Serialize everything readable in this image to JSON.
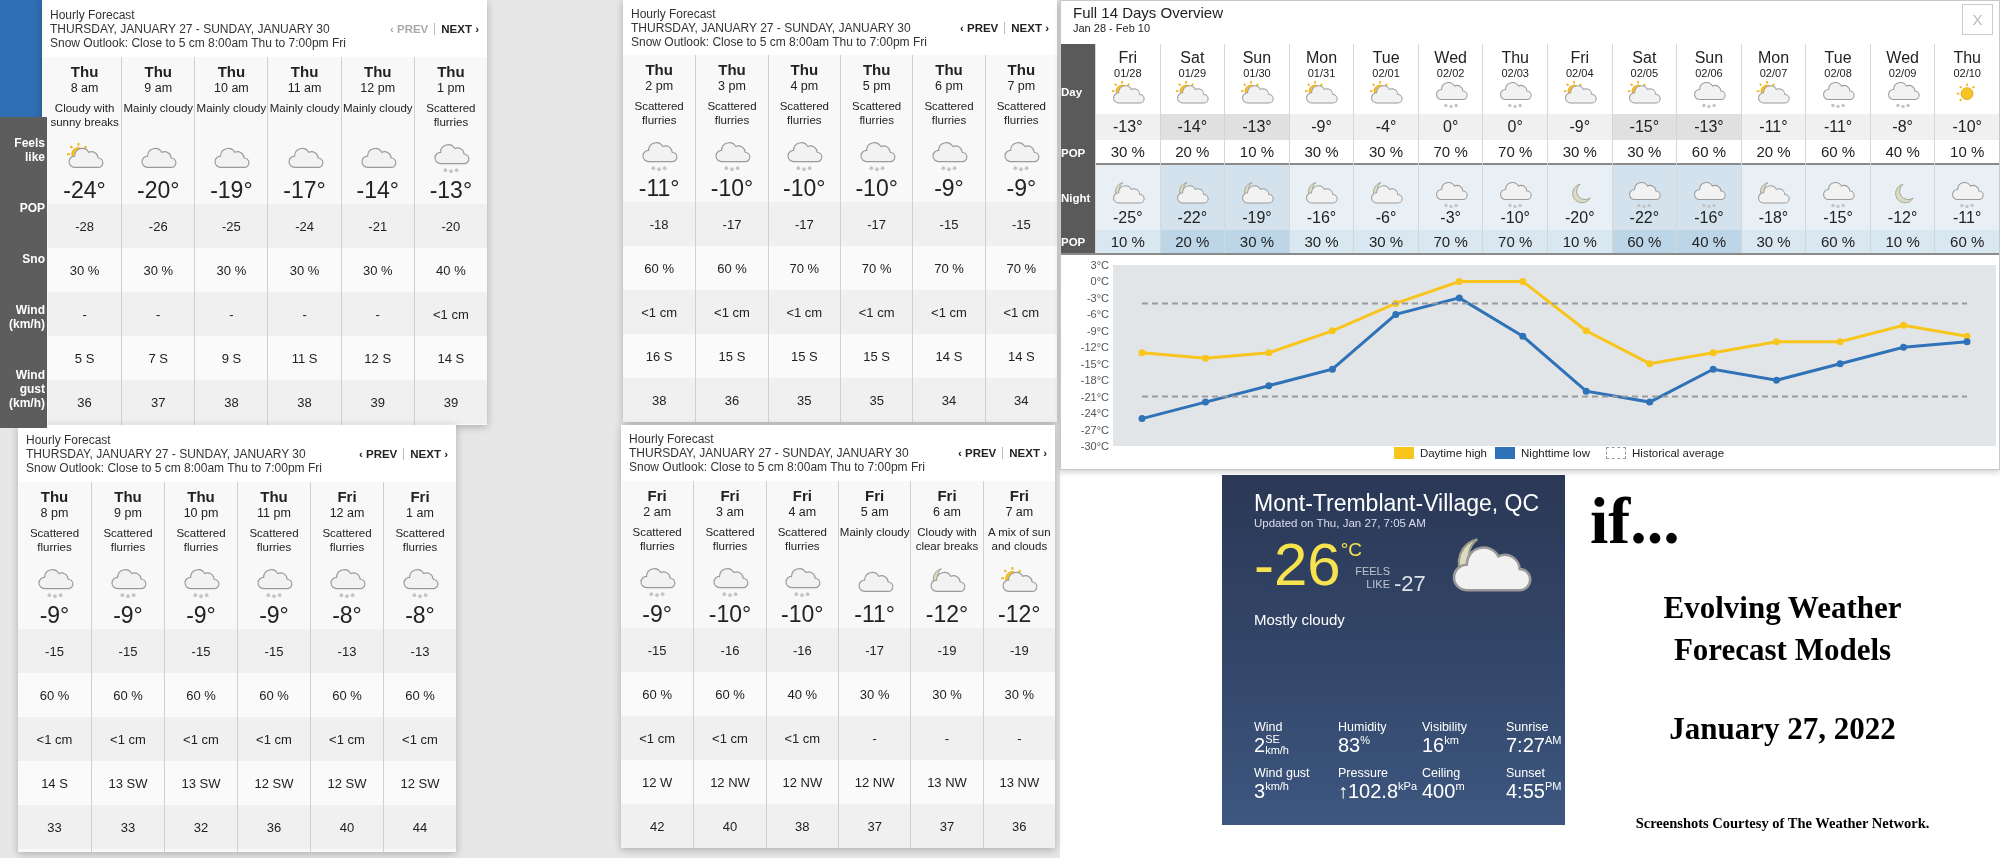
{
  "hourly_panels": [
    {
      "title": "Hourly Forecast",
      "dates": "THURSDAY, JANUARY 27 - SUNDAY, JANUARY 30",
      "outlook": "Snow Outlook: Close to 5 cm 8:00am Thu to 7:00pm Fri",
      "prev": {
        "label": "‹ PREV",
        "disabled": true
      },
      "next": {
        "label": "NEXT ›",
        "disabled": false
      },
      "row_labels": [
        "Feels like",
        "POP",
        "Sno",
        "Wind (km/h)",
        "Wind gust (km/h)"
      ],
      "hours": [
        {
          "day": "Thu",
          "time": "8 am",
          "condition": "Cloudy with sunny breaks",
          "kind": "sun-cloud",
          "temp": "-24°",
          "feels": "-28",
          "pop": "30 %",
          "snow": "-",
          "wind": "5 S",
          "gust": "36"
        },
        {
          "day": "Thu",
          "time": "9 am",
          "condition": "Mainly cloudy",
          "kind": "cloud",
          "temp": "-20°",
          "feels": "-26",
          "pop": "30 %",
          "snow": "-",
          "wind": "7 S",
          "gust": "37"
        },
        {
          "day": "Thu",
          "time": "10 am",
          "condition": "Mainly cloudy",
          "kind": "cloud",
          "temp": "-19°",
          "feels": "-25",
          "pop": "30 %",
          "snow": "-",
          "wind": "9 S",
          "gust": "38"
        },
        {
          "day": "Thu",
          "time": "11 am",
          "condition": "Mainly cloudy",
          "kind": "cloud",
          "temp": "-17°",
          "feels": "-24",
          "pop": "30 %",
          "snow": "-",
          "wind": "11 S",
          "gust": "38"
        },
        {
          "day": "Thu",
          "time": "12 pm",
          "condition": "Mainly cloudy",
          "kind": "cloud",
          "temp": "-14°",
          "feels": "-21",
          "pop": "30 %",
          "snow": "-",
          "wind": "12 S",
          "gust": "39"
        },
        {
          "day": "Thu",
          "time": "1 pm",
          "condition": "Scattered flurries",
          "kind": "snow",
          "temp": "-13°",
          "feels": "-20",
          "pop": "40 %",
          "snow": "<1 cm",
          "wind": "14 S",
          "gust": "39"
        }
      ]
    },
    {
      "title": "Hourly Forecast",
      "dates": "THURSDAY, JANUARY 27 - SUNDAY, JANUARY 30",
      "outlook": "Snow Outlook: Close to 5 cm 8:00am Thu to 7:00pm Fri",
      "prev": {
        "label": "‹ PREV",
        "disabled": false
      },
      "next": {
        "label": "NEXT ›",
        "disabled": false
      },
      "hours": [
        {
          "day": "Thu",
          "time": "2 pm",
          "condition": "Scattered flurries",
          "kind": "snow",
          "temp": "-11°",
          "feels": "-18",
          "pop": "60 %",
          "snow": "<1 cm",
          "wind": "16 S",
          "gust": "38"
        },
        {
          "day": "Thu",
          "time": "3 pm",
          "condition": "Scattered flurries",
          "kind": "snow",
          "temp": "-10°",
          "feels": "-17",
          "pop": "60 %",
          "snow": "<1 cm",
          "wind": "15 S",
          "gust": "36"
        },
        {
          "day": "Thu",
          "time": "4 pm",
          "condition": "Scattered flurries",
          "kind": "snow",
          "temp": "-10°",
          "feels": "-17",
          "pop": "70 %",
          "snow": "<1 cm",
          "wind": "15 S",
          "gust": "35"
        },
        {
          "day": "Thu",
          "time": "5 pm",
          "condition": "Scattered flurries",
          "kind": "snow",
          "temp": "-10°",
          "feels": "-17",
          "pop": "70 %",
          "snow": "<1 cm",
          "wind": "15 S",
          "gust": "35"
        },
        {
          "day": "Thu",
          "time": "6 pm",
          "condition": "Scattered flurries",
          "kind": "snow",
          "temp": "-9°",
          "feels": "-15",
          "pop": "70 %",
          "snow": "<1 cm",
          "wind": "14 S",
          "gust": "34"
        },
        {
          "day": "Thu",
          "time": "7 pm",
          "condition": "Scattered flurries",
          "kind": "snow",
          "temp": "-9°",
          "feels": "-15",
          "pop": "70 %",
          "snow": "<1 cm",
          "wind": "14 S",
          "gust": "34"
        }
      ]
    },
    {
      "title": "Hourly Forecast",
      "dates": "THURSDAY, JANUARY 27 - SUNDAY, JANUARY 30",
      "outlook": "Snow Outlook: Close to 5 cm 8:00am Thu to 7:00pm Fri",
      "prev": {
        "label": "‹ PREV",
        "disabled": false
      },
      "next": {
        "label": "NEXT ›",
        "disabled": false
      },
      "hours": [
        {
          "day": "Thu",
          "time": "8 pm",
          "condition": "Scattered flurries",
          "kind": "snow",
          "temp": "-9°",
          "feels": "-15",
          "pop": "60 %",
          "snow": "<1 cm",
          "wind": "14 S",
          "gust": "33"
        },
        {
          "day": "Thu",
          "time": "9 pm",
          "condition": "Scattered flurries",
          "kind": "snow",
          "temp": "-9°",
          "feels": "-15",
          "pop": "60 %",
          "snow": "<1 cm",
          "wind": "13 SW",
          "gust": "33"
        },
        {
          "day": "Thu",
          "time": "10 pm",
          "condition": "Scattered flurries",
          "kind": "snow",
          "temp": "-9°",
          "feels": "-15",
          "pop": "60 %",
          "snow": "<1 cm",
          "wind": "13 SW",
          "gust": "32"
        },
        {
          "day": "Thu",
          "time": "11 pm",
          "condition": "Scattered flurries",
          "kind": "snow",
          "temp": "-9°",
          "feels": "-15",
          "pop": "60 %",
          "snow": "<1 cm",
          "wind": "12 SW",
          "gust": "36"
        },
        {
          "day": "Fri",
          "time": "12 am",
          "condition": "Scattered flurries",
          "kind": "snow",
          "temp": "-8°",
          "feels": "-13",
          "pop": "60 %",
          "snow": "<1 cm",
          "wind": "12 SW",
          "gust": "40"
        },
        {
          "day": "Fri",
          "time": "1 am",
          "condition": "Scattered flurries",
          "kind": "snow",
          "temp": "-8°",
          "feels": "-13",
          "pop": "60 %",
          "snow": "<1 cm",
          "wind": "12 SW",
          "gust": "44"
        }
      ]
    },
    {
      "title": "Hourly Forecast",
      "dates": "THURSDAY, JANUARY 27 - SUNDAY, JANUARY 30",
      "outlook": "Snow Outlook: Close to 5 cm 8:00am Thu to 7:00pm Fri",
      "prev": {
        "label": "‹ PREV",
        "disabled": false
      },
      "next": {
        "label": "NEXT ›",
        "disabled": false
      },
      "hours": [
        {
          "day": "Fri",
          "time": "2 am",
          "condition": "Scattered flurries",
          "kind": "snow",
          "temp": "-9°",
          "feels": "-15",
          "pop": "60 %",
          "snow": "<1 cm",
          "wind": "12 W",
          "gust": "42"
        },
        {
          "day": "Fri",
          "time": "3 am",
          "condition": "Scattered flurries",
          "kind": "snow",
          "temp": "-10°",
          "feels": "-16",
          "pop": "60 %",
          "snow": "<1 cm",
          "wind": "12 NW",
          "gust": "40"
        },
        {
          "day": "Fri",
          "time": "4 am",
          "condition": "Scattered flurries",
          "kind": "snow",
          "temp": "-10°",
          "feels": "-16",
          "pop": "40 %",
          "snow": "<1 cm",
          "wind": "12 NW",
          "gust": "38"
        },
        {
          "day": "Fri",
          "time": "5 am",
          "condition": "Mainly cloudy",
          "kind": "cloud",
          "temp": "-11°",
          "feels": "-17",
          "pop": "30 %",
          "snow": "-",
          "wind": "12 NW",
          "gust": "37"
        },
        {
          "day": "Fri",
          "time": "6 am",
          "condition": "Cloudy with clear breaks",
          "kind": "moon-cloud",
          "temp": "-12°",
          "feels": "-19",
          "pop": "30 %",
          "snow": "-",
          "wind": "13 NW",
          "gust": "37"
        },
        {
          "day": "Fri",
          "time": "7 am",
          "condition": "A mix of sun and clouds",
          "kind": "sun-cloud",
          "temp": "-12°",
          "feels": "-19",
          "pop": "30 %",
          "snow": "-",
          "wind": "13 NW",
          "gust": "36"
        }
      ]
    }
  ],
  "overview": {
    "title": "Full 14 Days Overview",
    "range": "Jan 28 - Feb 10",
    "close": "X",
    "row_labels": [
      "Day",
      "POP",
      "Night",
      "POP"
    ],
    "days": [
      {
        "day": "Fri",
        "date": "01/28",
        "highlighted": false,
        "daytime": {
          "kind": "sun-cloud",
          "temp": "-13°",
          "pop": "30 %"
        },
        "night": {
          "kind": "moon-cloud",
          "temp": "-25°",
          "pop": "10 %"
        }
      },
      {
        "day": "Sat",
        "date": "01/29",
        "highlighted": true,
        "daytime": {
          "kind": "sun-cloud",
          "temp": "-14°",
          "pop": "20 %"
        },
        "night": {
          "kind": "moon-cloud",
          "temp": "-22°",
          "pop": "20 %"
        }
      },
      {
        "day": "Sun",
        "date": "01/30",
        "highlighted": true,
        "daytime": {
          "kind": "sun-cloud",
          "temp": "-13°",
          "pop": "10 %"
        },
        "night": {
          "kind": "moon-cloud",
          "temp": "-19°",
          "pop": "30 %"
        }
      },
      {
        "day": "Mon",
        "date": "01/31",
        "highlighted": false,
        "daytime": {
          "kind": "sun-cloud",
          "temp": "-9°",
          "pop": "30 %"
        },
        "night": {
          "kind": "moon-cloud",
          "temp": "-16°",
          "pop": "30 %"
        }
      },
      {
        "day": "Tue",
        "date": "02/01",
        "highlighted": false,
        "daytime": {
          "kind": "sun-cloud",
          "temp": "-4°",
          "pop": "30 %"
        },
        "night": {
          "kind": "moon-cloud",
          "temp": "-6°",
          "pop": "30 %"
        }
      },
      {
        "day": "Wed",
        "date": "02/02",
        "highlighted": false,
        "daytime": {
          "kind": "snow",
          "temp": "0°",
          "pop": "70 %"
        },
        "night": {
          "kind": "snow",
          "temp": "-3°",
          "pop": "70 %"
        }
      },
      {
        "day": "Thu",
        "date": "02/03",
        "highlighted": false,
        "daytime": {
          "kind": "snow",
          "temp": "0°",
          "pop": "70 %"
        },
        "night": {
          "kind": "snow",
          "temp": "-10°",
          "pop": "70 %"
        }
      },
      {
        "day": "Fri",
        "date": "02/04",
        "highlighted": false,
        "daytime": {
          "kind": "sun-cloud",
          "temp": "-9°",
          "pop": "30 %"
        },
        "night": {
          "kind": "moon",
          "temp": "-20°",
          "pop": "10 %"
        }
      },
      {
        "day": "Sat",
        "date": "02/05",
        "highlighted": true,
        "daytime": {
          "kind": "sun-cloud",
          "temp": "-15°",
          "pop": "30 %"
        },
        "night": {
          "kind": "snow",
          "temp": "-22°",
          "pop": "60 %"
        }
      },
      {
        "day": "Sun",
        "date": "02/06",
        "highlighted": true,
        "daytime": {
          "kind": "snow",
          "temp": "-13°",
          "pop": "60 %"
        },
        "night": {
          "kind": "snow",
          "temp": "-16°",
          "pop": "40 %"
        }
      },
      {
        "day": "Mon",
        "date": "02/07",
        "highlighted": false,
        "daytime": {
          "kind": "sun-cloud",
          "temp": "-11°",
          "pop": "20 %"
        },
        "night": {
          "kind": "moon-cloud",
          "temp": "-18°",
          "pop": "30 %"
        }
      },
      {
        "day": "Tue",
        "date": "02/08",
        "highlighted": false,
        "daytime": {
          "kind": "snow",
          "temp": "-11°",
          "pop": "60 %"
        },
        "night": {
          "kind": "snow",
          "temp": "-15°",
          "pop": "60 %"
        }
      },
      {
        "day": "Wed",
        "date": "02/09",
        "highlighted": false,
        "daytime": {
          "kind": "snow",
          "temp": "-8°",
          "pop": "40 %"
        },
        "night": {
          "kind": "moon",
          "temp": "-12°",
          "pop": "10 %"
        }
      },
      {
        "day": "Thu",
        "date": "02/10",
        "highlighted": false,
        "daytime": {
          "kind": "sun",
          "temp": "-10°",
          "pop": "10 %"
        },
        "night": {
          "kind": "snow",
          "temp": "-11°",
          "pop": "60 %"
        }
      }
    ],
    "chart_data": {
      "type": "line",
      "legend": "bottom",
      "series": [
        {
          "name": "Daytime high",
          "color": "#f8c51c",
          "marker": "circle",
          "values": [
            -13,
            -14,
            -13,
            -9,
            -4,
            0,
            0,
            -9,
            -15,
            -13,
            -11,
            -11,
            -8,
            -10
          ]
        },
        {
          "name": "Nighttime low",
          "color": "#2f72b8",
          "marker": "circle",
          "values": [
            -25,
            -22,
            -19,
            -16,
            -6,
            -3,
            -10,
            -20,
            -22,
            -16,
            -18,
            -15,
            -12,
            -11
          ]
        },
        {
          "name": "Historical average",
          "color": "#9a9a9a",
          "line_style": "dashed",
          "values": [
            -4,
            -4,
            -4,
            -4,
            -4,
            -4,
            -4,
            -4,
            -4,
            -4,
            -4,
            -4,
            -4,
            -4
          ]
        },
        {
          "color": "#9a9a9a",
          "line_style": "dashed",
          "values": [
            -21,
            -21,
            -21,
            -21,
            -21,
            -21,
            -21,
            -21,
            -21,
            -21,
            -21,
            -21,
            -21,
            -21
          ]
        }
      ],
      "ylim": [
        -30,
        3
      ],
      "yticks": [
        {
          "value": 3,
          "label": "3°C"
        },
        {
          "value": 0,
          "label": "0°C"
        },
        {
          "value": -3,
          "label": "-3°C"
        },
        {
          "value": -6,
          "label": "-6°C"
        },
        {
          "value": -9,
          "label": "-9°C"
        },
        {
          "value": -12,
          "label": "-12°C"
        },
        {
          "value": -15,
          "label": "-15°C"
        },
        {
          "value": -18,
          "label": "-18°C"
        },
        {
          "value": -21,
          "label": "-21°C"
        },
        {
          "value": -24,
          "label": "-24°C"
        },
        {
          "value": -27,
          "label": "-27°C"
        },
        {
          "value": -30,
          "label": "-30°C"
        }
      ]
    }
  },
  "current": {
    "location": "Mont-Tremblant-Village, QC",
    "updated": "Updated on Thu, Jan 27, 7:05 AM",
    "temp": "-26",
    "unit": "°C",
    "feels_label": "FEELS LIKE",
    "feels": "-27",
    "kind": "moon-cloud",
    "condition": "Mostly cloudy",
    "stats": [
      {
        "label": "Wind",
        "value": "2",
        "direction": "SE",
        "unit": "km/h"
      },
      {
        "label": "Humidity",
        "value": "83",
        "unit": "%"
      },
      {
        "label": "Visibility",
        "value": "16",
        "unit": "km"
      },
      {
        "label": "Sunrise",
        "value": "7:27",
        "unit": "AM"
      },
      {
        "label": "Wind gust",
        "value": "3",
        "unit": "km/h"
      },
      {
        "label": "Pressure",
        "value": "↑102.8",
        "unit": "kPa"
      },
      {
        "label": "Ceiling",
        "value": "400",
        "unit": "m"
      },
      {
        "label": "Sunset",
        "value": "4:55",
        "unit": "PM"
      }
    ]
  },
  "caption": {
    "lead": "if...",
    "title": "Evolving Weather Forecast Models",
    "date": "January 27, 2022",
    "credit": "Screenshots Courtesy of The Weather Network."
  }
}
